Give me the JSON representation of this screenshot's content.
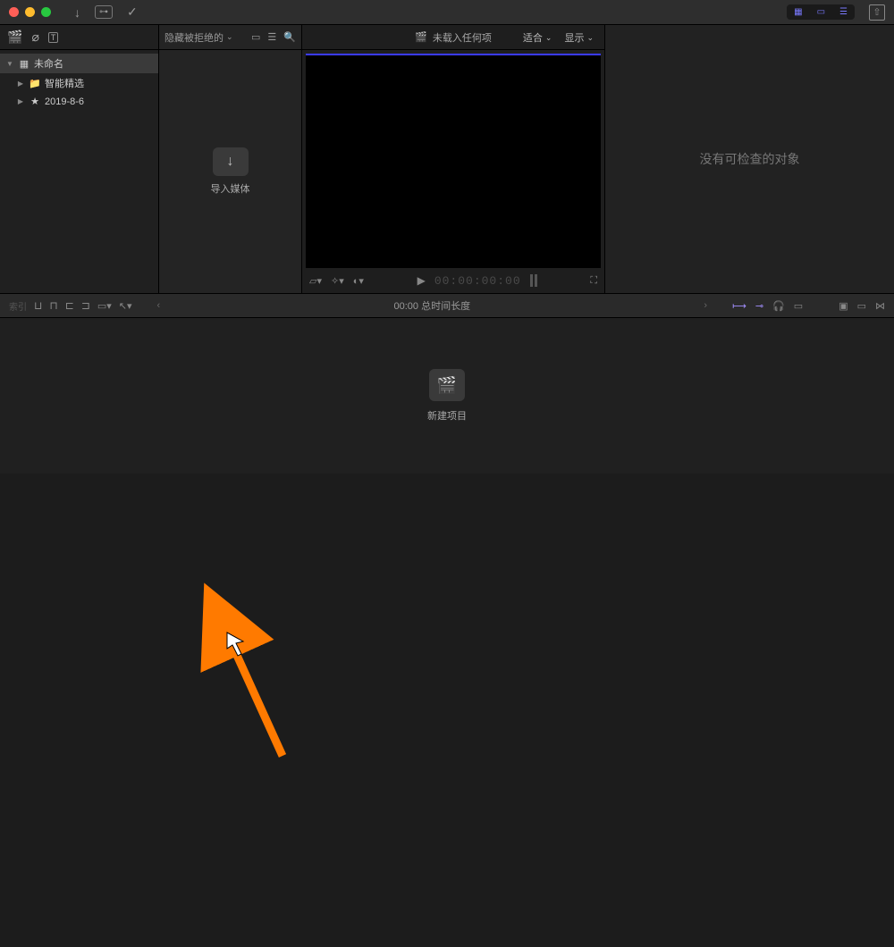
{
  "titlebar": {},
  "sidebar": {
    "root": "未命名",
    "items": [
      "智能精选",
      "2019-8-6"
    ]
  },
  "browser": {
    "filter_label": "隐藏被拒绝的",
    "import_label": "导入媒体"
  },
  "viewer": {
    "not_loaded": "未载入任何项",
    "fit_label": "适合",
    "display_label": "显示",
    "timecode": "00:00:00:00"
  },
  "inspector": {
    "empty": "没有可检查的对象"
  },
  "timeline_header": {
    "duration": "00:00 总时间长度"
  },
  "timeline": {
    "new_project": "新建项目"
  }
}
